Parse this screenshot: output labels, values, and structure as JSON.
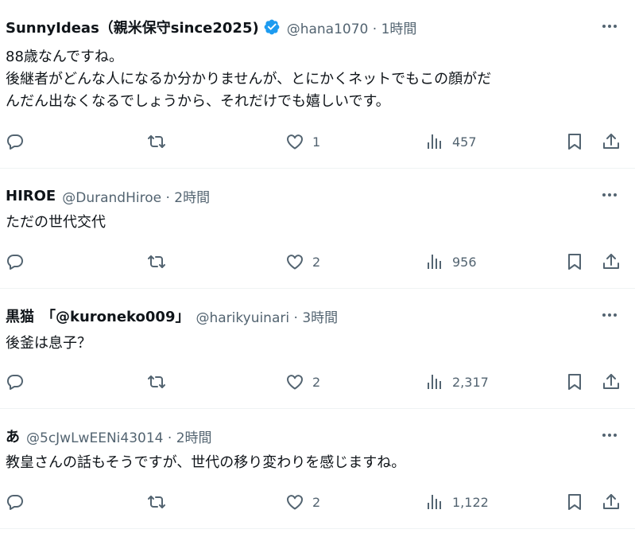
{
  "posts": [
    {
      "name": "SunnyIdeas（親米保守since2025)",
      "verified": true,
      "handle": "@hana1070",
      "time": "1時間",
      "lines": [
        "88歳なんですね。",
        "後継者がどんな人になるか分かりませんが、とにかくネットでもこの顔がだ",
        "んだん出なくなるでしょうから、それだけでも嬉しいです。"
      ],
      "likes": "1",
      "views": "457"
    },
    {
      "name": "HIROE",
      "verified": false,
      "handle": "@DurandHiroe",
      "time": "2時間",
      "lines": [
        "ただの世代交代"
      ],
      "likes": "2",
      "views": "956"
    },
    {
      "name": "黒猫　「@kuroneko009」",
      "verified": false,
      "handle": "@harikyuinari",
      "time": "3時間",
      "lines": [
        "後釜は息子？"
      ],
      "likes": "2",
      "views": "2,317"
    },
    {
      "name": "あ",
      "verified": false,
      "handle": "@5cJwLwEENi43014",
      "time": "2時間",
      "lines": [
        "教皇さんの話もそうですが、世代の移り変わりを感じますね。"
      ],
      "likes": "2",
      "views": "1,122"
    }
  ],
  "separator": "·",
  "icons": {
    "more": "more-horizontal-icon",
    "reply": "reply-icon",
    "repost": "repost-icon",
    "like": "heart-icon",
    "views": "views-bar-chart-icon",
    "bookmark": "bookmark-icon",
    "share": "share-icon"
  },
  "colors": {
    "text": "#0f1419",
    "secondary": "#536471",
    "verified": "#1d9bf0",
    "divider": "#eff3f4"
  }
}
